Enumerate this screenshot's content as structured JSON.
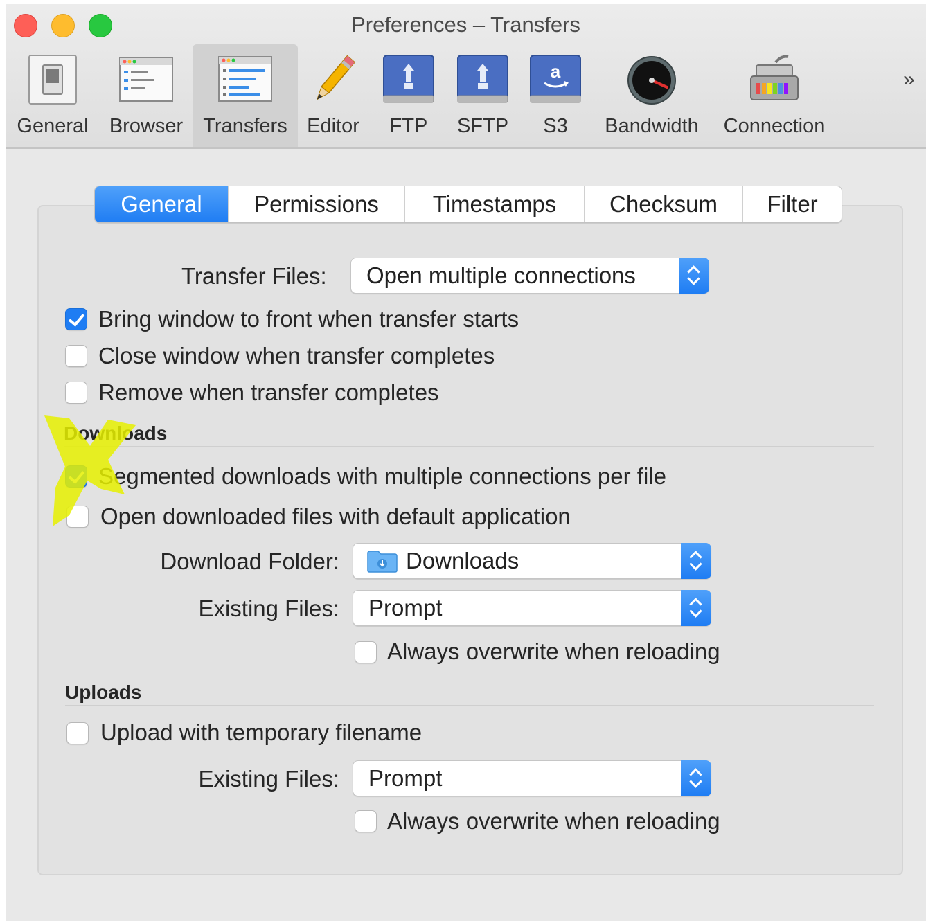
{
  "window": {
    "title": "Preferences – Transfers"
  },
  "toolbar": {
    "items": [
      {
        "label": "General",
        "icon": "switch-icon"
      },
      {
        "label": "Browser",
        "icon": "browser-window-icon"
      },
      {
        "label": "Transfers",
        "icon": "transfers-window-icon",
        "selected": true
      },
      {
        "label": "Editor",
        "icon": "pencil-icon"
      },
      {
        "label": "FTP",
        "icon": "ftp-drive-icon"
      },
      {
        "label": "SFTP",
        "icon": "sftp-drive-icon"
      },
      {
        "label": "S3",
        "icon": "s3-drive-icon"
      },
      {
        "label": "Bandwidth",
        "icon": "gauge-icon"
      },
      {
        "label": "Connection",
        "icon": "network-card-icon"
      }
    ],
    "overflow": "»"
  },
  "tabs": [
    {
      "label": "General",
      "active": true
    },
    {
      "label": "Permissions"
    },
    {
      "label": "Timestamps"
    },
    {
      "label": "Checksum"
    },
    {
      "label": "Filter"
    }
  ],
  "general": {
    "transfer_files_label": "Transfer Files:",
    "transfer_files_value": "Open multiple connections",
    "bring_front": {
      "label": "Bring window to front when transfer starts",
      "checked": true
    },
    "close_window": {
      "label": "Close window when transfer completes",
      "checked": false
    },
    "remove_complete": {
      "label": "Remove when transfer completes",
      "checked": false
    }
  },
  "downloads": {
    "heading": "Downloads",
    "segmented": {
      "label": "Segmented downloads with multiple connections per file",
      "checked": true
    },
    "open_default": {
      "label": "Open downloaded files with default application",
      "checked": false
    },
    "folder_label": "Download Folder:",
    "folder_value": "Downloads",
    "existing_label": "Existing Files:",
    "existing_value": "Prompt",
    "overwrite": {
      "label": "Always overwrite when reloading",
      "checked": false
    }
  },
  "uploads": {
    "heading": "Uploads",
    "temp_filename": {
      "label": "Upload with temporary filename",
      "checked": false
    },
    "existing_label": "Existing Files:",
    "existing_value": "Prompt",
    "overwrite": {
      "label": "Always overwrite when reloading",
      "checked": false
    }
  },
  "colors": {
    "accent": "#1f7df3",
    "highlight_marker": "#e6f000"
  }
}
